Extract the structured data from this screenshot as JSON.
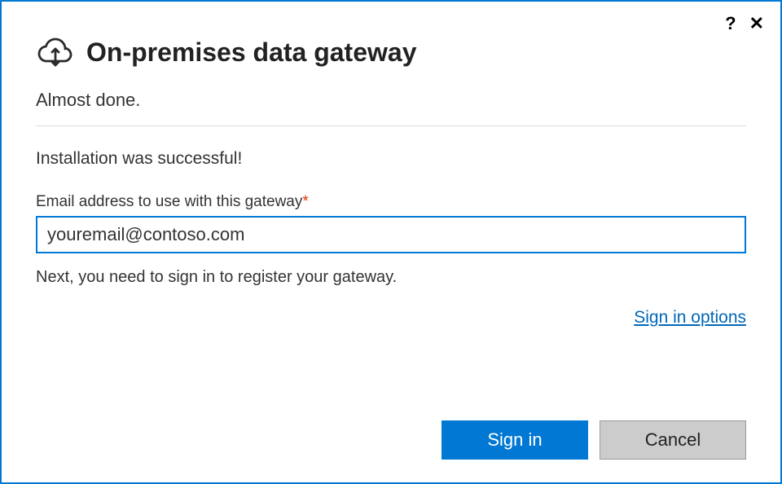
{
  "titlebar": {
    "help_symbol": "?",
    "close_symbol": "✕"
  },
  "header": {
    "app_title": "On-premises data gateway"
  },
  "subtitle": "Almost done.",
  "status_message": "Installation was successful!",
  "email_field": {
    "label": "Email address to use with this gateway",
    "required_mark": "*",
    "value": "youremail@contoso.com"
  },
  "next_message": "Next, you need to sign in to register your gateway.",
  "links": {
    "signin_options": "Sign in options"
  },
  "buttons": {
    "signin": "Sign in",
    "cancel": "Cancel"
  }
}
